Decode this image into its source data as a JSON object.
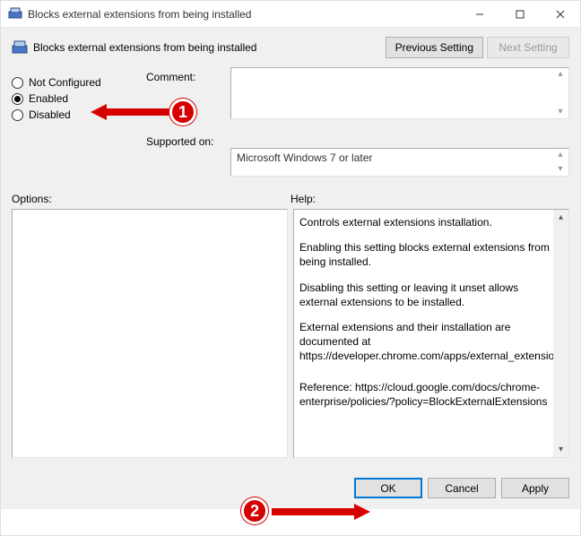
{
  "window": {
    "title": "Blocks external extensions from being installed",
    "policy_title": "Blocks external extensions from being installed"
  },
  "nav": {
    "previous": "Previous Setting",
    "next": "Next Setting"
  },
  "state": {
    "not_configured": "Not Configured",
    "enabled": "Enabled",
    "disabled": "Disabled",
    "selected": "enabled"
  },
  "labels": {
    "comment": "Comment:",
    "supported_on": "Supported on:",
    "options": "Options:",
    "help": "Help:"
  },
  "supported": "Microsoft Windows 7 or later",
  "help": {
    "p1": "Controls external extensions installation.",
    "p2": "Enabling this setting blocks external extensions from being installed.",
    "p3": "Disabling this setting or leaving it unset allows external extensions to be installed.",
    "p4": "External extensions and their installation are documented at https://developer.chrome.com/apps/external_extensions.",
    "p5": "Reference: https://cloud.google.com/docs/chrome-enterprise/policies/?policy=BlockExternalExtensions"
  },
  "buttons": {
    "ok": "OK",
    "cancel": "Cancel",
    "apply": "Apply"
  },
  "annotations": {
    "b1": "1",
    "b2": "2"
  }
}
